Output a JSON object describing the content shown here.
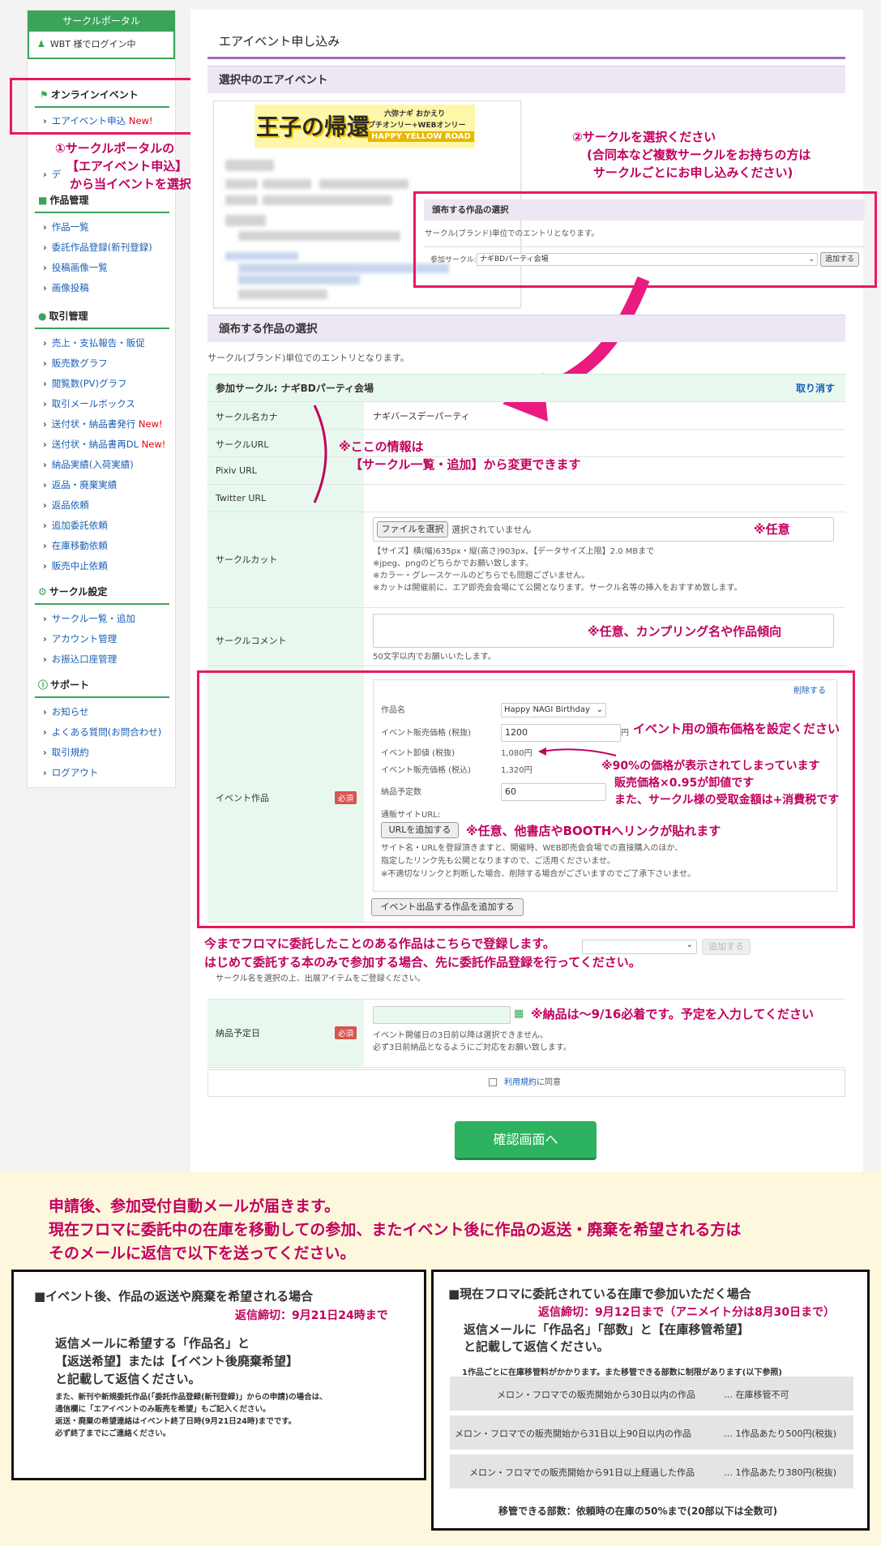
{
  "sidebar": {
    "header": "サークルポータル",
    "login": "WBT 様でログイン中",
    "sections": [
      {
        "title": "オンラインイベント",
        "items": [
          {
            "label": "エアイベント申込",
            "new": "New!"
          }
        ]
      },
      {
        "title": "作品管理",
        "items": [
          {
            "label": "作品一覧"
          },
          {
            "label": "委託作品登録(新刊登録)"
          },
          {
            "label": "投稿画像一覧"
          },
          {
            "label": "画像投稿"
          }
        ]
      },
      {
        "title": "取引管理",
        "items": [
          {
            "label": "売上・支払報告・販促"
          },
          {
            "label": "販売数グラフ"
          },
          {
            "label": "閲覧数(PV)グラフ"
          },
          {
            "label": "取引メールボックス"
          },
          {
            "label": "送付状・納品書発行",
            "new": "New!"
          },
          {
            "label": "送付状・納品書再DL",
            "new": "New!"
          },
          {
            "label": "納品実績(入荷実績)"
          },
          {
            "label": "返品・廃棄実績"
          },
          {
            "label": "返品依頼"
          },
          {
            "label": "追加委託依頼"
          },
          {
            "label": "在庫移動依頼"
          },
          {
            "label": "販売中止依頼"
          }
        ]
      },
      {
        "title": "サークル設定",
        "items": [
          {
            "label": "サークル一覧・追加"
          },
          {
            "label": "アカウント管理"
          },
          {
            "label": "お振込口座管理"
          }
        ]
      },
      {
        "title": "サポート",
        "items": [
          {
            "label": "お知らせ"
          },
          {
            "label": "よくある質問(お問合わせ)"
          },
          {
            "label": "取引規約"
          },
          {
            "label": "ログアウト"
          }
        ]
      }
    ],
    "hidden_item_prefix": "デ"
  },
  "main": {
    "page_title": "エアイベント申し込み",
    "selected_event_header": "選択中のエアイベント",
    "event_banner": {
      "big": "王子の帰還",
      "line1": "六弥ナギ おかえり",
      "line2": "プチオンリー+WEBオンリー",
      "line3": "HAPPY YELLOW ROAD"
    },
    "works_header": "頒布する作品の選択",
    "works_note": "サークル(ブランド)単位でのエントリとなります。",
    "inset": {
      "header": "頒布する作品の選択",
      "note": "サークル(ブランド)単位でのエントリとなります。",
      "label": "参加サークル:",
      "select": "ナギBDパーティ会場",
      "add": "追加する"
    },
    "circle_title": "参加サークル: ナギBDパーティ会場",
    "cancel": "取り消す",
    "rows": {
      "kana": "サークル名カナ",
      "kana_value": "ナギバースデーパーティ",
      "url": "サークルURL",
      "pixiv": "Pixiv URL",
      "twitter": "Twitter URL",
      "cut": "サークルカット",
      "comment": "サークルコメント",
      "event_work": "イベント作品",
      "delivery": "納品予定日"
    },
    "file_btn": "ファイルを選択",
    "file_none": "選択されていません",
    "cut_notes": [
      "【サイズ】横(幅)635px・縦(高さ)903px、【データサイズ上限】2.0 MBまで",
      "※jpeg、pngのどちらかでお願い致します。",
      "※カラー・グレースケールのどちらでも問題ございません。",
      "※カットは開催前に、エア即売会会場にて公開となります。サークル名等の挿入をおすすめ致します。"
    ],
    "comment_note": "50文字以内でお願いいたします。",
    "work": {
      "delete": "削除する",
      "name_label": "作品名",
      "name_value": "Happy NAGI Birthday",
      "price_label": "イベント販売価格 (税抜)",
      "price_value": "1200",
      "yen": "円",
      "wholesale_label": "イベント卸値 (税抜)",
      "wholesale_value": "1,080円",
      "price_tax_label": "イベント販売価格 (税込)",
      "price_tax_value": "1,320円",
      "qty_label": "納品予定数",
      "qty_value": "60",
      "url_label": "通販サイトURL:",
      "url_btn": "URLを追加する",
      "url_notes": [
        "サイト名・URLを登録頂きますと、開催時、WEB即売会会場での直接購入のほか、",
        "指定したリンク先も公開となりますので、ご活用くださいませ。",
        "※不適切なリンクと判断した場合、削除する場合がございますのでご了承下さいませ。"
      ],
      "add_work": "イベント出品する作品を追加する"
    },
    "required": "必須",
    "select_add": "追加する",
    "select_note": "サークル名を選択の上、出展アイテムをご登録ください。",
    "delivery_notes": [
      "イベント開催日の3日前以降は選択できません。",
      "必ず3日前納品となるようにご対応をお願い致します。"
    ],
    "agree_link": "利用規約",
    "agree_rest": "に同意",
    "confirm": "確認画面へ"
  },
  "annotations": {
    "a1": [
      "①サークルポータルの",
      "【エアイベント申込】",
      "から当イベントを選択"
    ],
    "a2": [
      "②サークルを選択ください",
      "(合同本など複数サークルをお持ちの方は",
      "サークルごとにお申し込みください)"
    ],
    "a3": [
      "※ここの情報は",
      "【サークル一覧・追加】から変更できます"
    ],
    "opt1": "※任意",
    "opt2": "※任意、カンプリング名や作品傾向",
    "price": "イベント用の頒布価格を設定ください",
    "wholesale": [
      "※90%の価格が表示されてしまっています",
      "販売価格×0.95が卸値です",
      "また、サークル様の受取金額は+消費税です"
    ],
    "urlnote": "※任意、他書店やBOOTHへリンクが貼れます",
    "past": [
      "今までフロマに委託したことのある作品はこちらで登録します。",
      "はじめて委託する本のみで参加する場合、先に委託作品登録を行ってください。"
    ],
    "delivery": "※納品は〜9/16必着です。予定を入力してください"
  },
  "footer": {
    "intro": [
      "申請後、参加受付自動メールが届きます。",
      "現在フロマに委託中の在庫を移動しての参加、またイベント後に作品の返送・廃棄を希望される方は",
      "そのメールに返信で以下を送ってください。"
    ],
    "left": {
      "title": "■イベント後、作品の返送や廃棄を希望される場合",
      "deadline": "返信締切：9月21日24時まで",
      "body": [
        "返信メールに希望する「作品名」と",
        "【返送希望】または【イベント後廃棄希望】",
        "と記載して返信ください。"
      ],
      "small": [
        "また、新刊や新規委託作品(「委託作品登録(新刊登録)」からの申請)の場合は、",
        "通信欄に「エアイベントのみ販売を希望」もご記入ください。",
        "返送・廃棄の希望連絡はイベント終了日時(9月21日24時)までです。",
        "必ず終了までにご連絡ください。"
      ]
    },
    "right": {
      "title": "■現在フロマに委託されている在庫で参加いただく場合",
      "deadline": "返信締切：9月12日まで（アニメイト分は8月30日まで）",
      "body": [
        "返信メールに「作品名」「部数」と【在庫移管希望】",
        "と記載して返信ください。"
      ],
      "fee": "1作品ごとに在庫移管料がかかります。また移管できる部数に制限があります(以下参照)",
      "table": [
        [
          "メロン・フロマでの販売開始から30日以内の作品",
          "… 在庫移管不可"
        ],
        [
          "メロン・フロマでの販売開始から31日以上90日以内の作品",
          "… 1作品あたり500円(税抜)"
        ],
        [
          "メロン・フロマでの販売開始から91日以上経過した作品",
          "… 1作品あたり380円(税抜)"
        ]
      ],
      "limit": "移管できる部数：依頼時の在庫の50%まで(20部以下は全数可)"
    }
  },
  "colors": {
    "green": "#3aa45b",
    "purple": "#9b6ec0",
    "annotation": "#c2005e",
    "highlight": "#e8195e"
  }
}
